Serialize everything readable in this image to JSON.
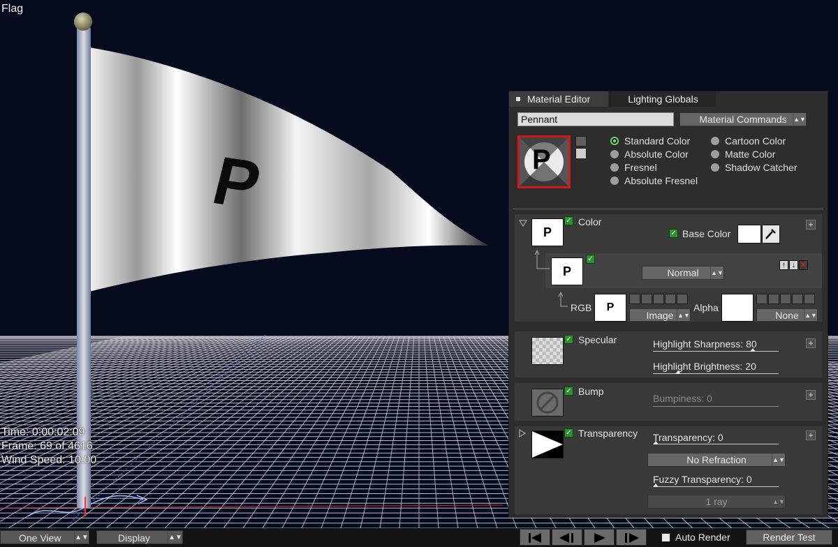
{
  "viewport": {
    "title": "Flag",
    "hud": {
      "time": "Time: 0:00:02:09",
      "frame": "Frame: 69 of 4616",
      "wind_speed": "Wind Speed: 10.00"
    },
    "flag_letter": "P"
  },
  "toolbar": {
    "view_select": "One View",
    "display_select": "Display",
    "auto_render_label": "Auto Render",
    "auto_render_checked": false,
    "render_test_label": "Render Test",
    "playback_icons": [
      "skip-to-start-icon",
      "step-back-icon",
      "play-icon",
      "step-forward-icon"
    ]
  },
  "material_editor": {
    "tabs": [
      {
        "label": "Material Editor",
        "active": true
      },
      {
        "label": "Lighting Globals",
        "active": false
      }
    ],
    "material_name": "Pennant",
    "commands_select": "Material Commands",
    "preview_letter": "P",
    "shading_options": [
      {
        "label": "Standard Color",
        "selected": true
      },
      {
        "label": "Absolute Color",
        "selected": false
      },
      {
        "label": "Fresnel",
        "selected": false
      },
      {
        "label": "Absolute Fresnel",
        "selected": false
      },
      {
        "label": "Cartoon Color",
        "selected": false
      },
      {
        "label": "Matte Color",
        "selected": false
      },
      {
        "label": "Shadow Catcher",
        "selected": false
      }
    ],
    "color": {
      "label": "Color",
      "thumb_letter": "P",
      "base_color_label": "Base Color",
      "base_color": "#ffffff",
      "blend_mode": "Normal",
      "rgb_label": "RGB",
      "rgb_source": "Image",
      "alpha_label": "Alpha",
      "alpha_source": "None"
    },
    "specular": {
      "label": "Specular",
      "highlight_sharpness": "Highlight Sharpness: 80",
      "highlight_sharpness_value": 80,
      "highlight_brightness": "Highlight Brightness: 20",
      "highlight_brightness_value": 20
    },
    "bump": {
      "label": "Bump",
      "bumpiness": "Bumpiness: 0"
    },
    "transparency": {
      "label": "Transparency",
      "transparency": "Transparency: 0",
      "refraction_select": "No Refraction",
      "fuzzy_transparency": "Fuzzy Transparency: 0",
      "rays_select": "1 ray"
    },
    "colors": {
      "panel_bg": "#2d2d2d",
      "checkbox_green": "#2f8f2f",
      "preview_border": "#d01818",
      "delete_red": "#d02020"
    }
  }
}
